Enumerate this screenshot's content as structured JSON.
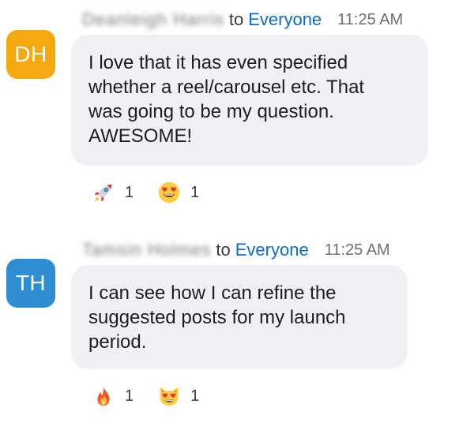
{
  "messages": [
    {
      "sender": "Deanleigh Harris",
      "to_word": "to",
      "recipient": "Everyone",
      "time": "11:25 AM",
      "avatar": {
        "initials": "DH",
        "color": "#f3a90f"
      },
      "text": "I love that it has even specified\nwhether a reel/carousel etc. That\nwas going to be my question.\nAWESOME!",
      "reactions": [
        {
          "icon": "rocket-icon",
          "count": "1"
        },
        {
          "icon": "heart-eyes-face-icon",
          "count": "1"
        }
      ]
    },
    {
      "sender": "Tamsin Holmes",
      "to_word": "to",
      "recipient": "Everyone",
      "time": "11:25 AM",
      "avatar": {
        "initials": "TH",
        "color": "#2f8ed1"
      },
      "text": "I can see how I can refine the\nsuggested posts for my launch\nperiod.",
      "reactions": [
        {
          "icon": "fire-icon",
          "count": "1"
        },
        {
          "icon": "heart-eyes-cat-icon",
          "count": "1"
        }
      ]
    }
  ]
}
